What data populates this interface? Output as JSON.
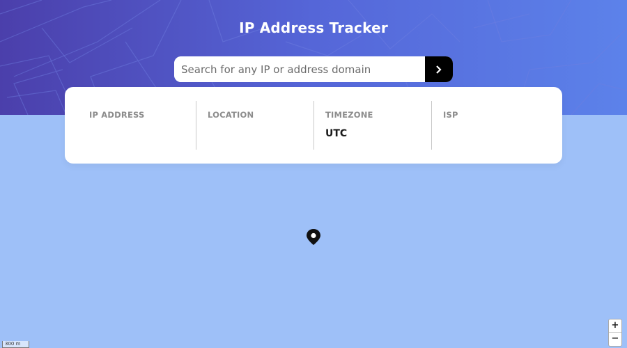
{
  "app": {
    "title": "IP Address Tracker"
  },
  "search": {
    "placeholder": "Search for any IP or address domain",
    "value": "",
    "submit_icon": "chevron-right-icon"
  },
  "info": [
    {
      "label": "IP ADDRESS",
      "value": ""
    },
    {
      "label": "LOCATION",
      "value": ""
    },
    {
      "label": "TIMEZONE",
      "value": "UTC"
    },
    {
      "label": "ISP",
      "value": ""
    }
  ],
  "map": {
    "marker_icon": "location-pin-icon",
    "zoom_in_label": "+",
    "zoom_out_label": "−",
    "scale_label": "300 m"
  },
  "colors": {
    "header_start": "#4b3fab",
    "header_end": "#5c82ea",
    "map_background": "#9ec0f8",
    "button": "#000000"
  }
}
